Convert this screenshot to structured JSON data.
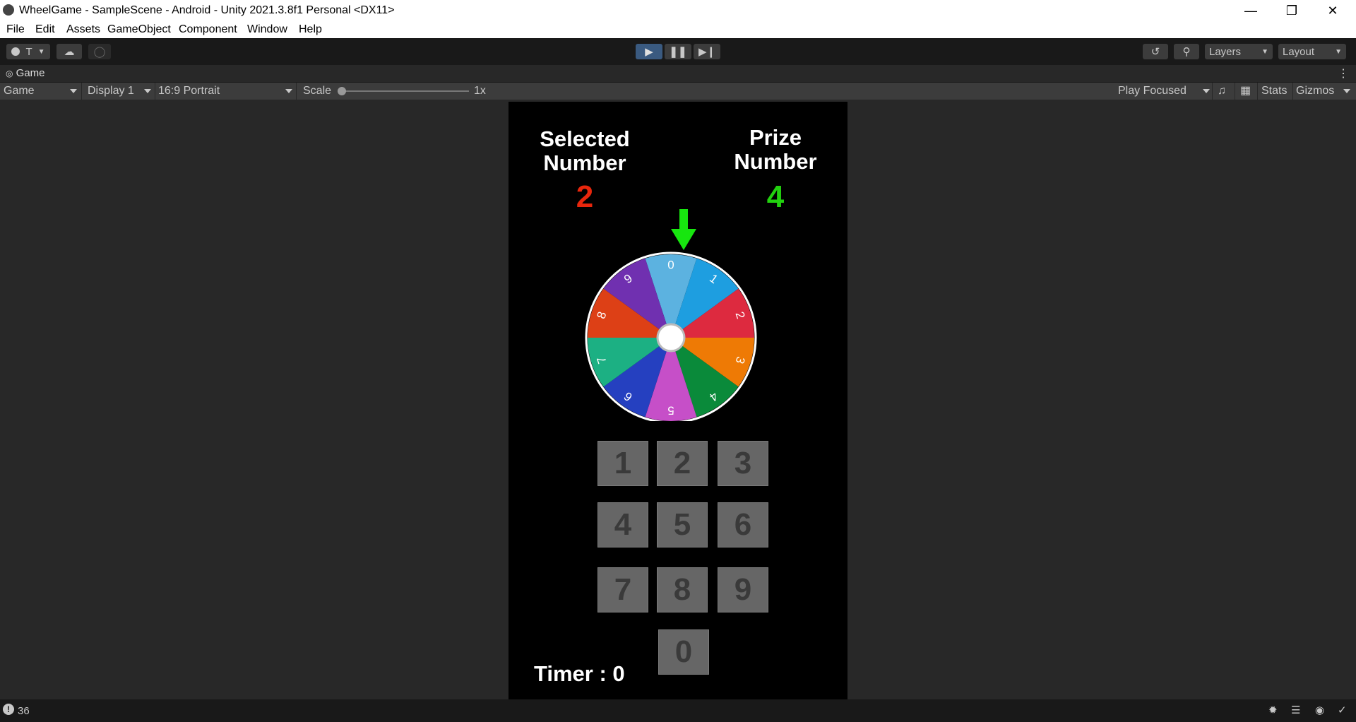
{
  "window": {
    "title": "WheelGame - SampleScene - Android - Unity 2021.3.8f1 Personal <DX11>"
  },
  "menu": [
    "File",
    "Edit",
    "Assets",
    "GameObject",
    "Component",
    "Window",
    "Help"
  ],
  "toolbar": {
    "account_label": "T",
    "layers_label": "Layers",
    "layout_label": "Layout"
  },
  "tab": {
    "label": "Game"
  },
  "gamebar": {
    "view_mode": "Game",
    "display": "Display 1",
    "aspect": "16:9 Portrait",
    "scale_label": "Scale",
    "scale_value": "1x",
    "play_mode": "Play Focused",
    "stats_label": "Stats",
    "gizmos_label": "Gizmos"
  },
  "game": {
    "selected_title_line1": "Selected",
    "selected_title_line2": "Number",
    "selected_value": "2",
    "prize_title_line1": "Prize",
    "prize_title_line2": "Number",
    "prize_value": "4",
    "wheel_segments": [
      "0",
      "1",
      "2",
      "3",
      "4",
      "5",
      "6",
      "7",
      "8",
      "9"
    ],
    "keypad": [
      "1",
      "2",
      "3",
      "4",
      "5",
      "6",
      "7",
      "8",
      "9",
      "0"
    ],
    "timer": "Timer : 0"
  },
  "colors": {
    "selected": "#e8260c",
    "prize": "#22d10f",
    "arrow": "#17e60f",
    "segments": [
      "#5cb2e0",
      "#1e9ee0",
      "#dd2a3f",
      "#ee7a05",
      "#0a8a3a",
      "#c64fc8",
      "#2540c0",
      "#1cb083",
      "#dd4016",
      "#7030b0"
    ]
  },
  "status": {
    "count": "36"
  }
}
